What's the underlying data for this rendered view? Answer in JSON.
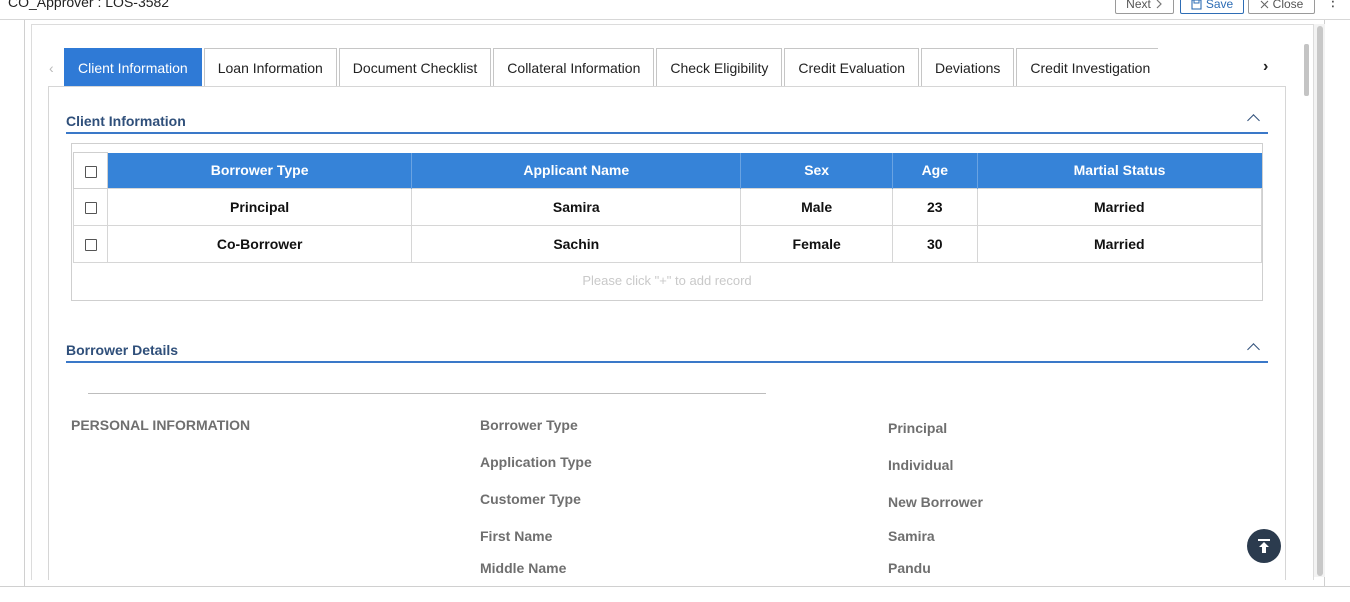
{
  "header": {
    "title": "CO_Approver : LOS-3582",
    "next_label": "Next",
    "save_label": "Save",
    "close_label": "Close",
    "next_icon": "chevron-right-icon",
    "save_icon": "save-icon",
    "close_icon": "close-icon",
    "menu_icon": "more-vertical-icon"
  },
  "tabs": [
    {
      "label": "Client Information",
      "active": true
    },
    {
      "label": "Loan Information",
      "active": false
    },
    {
      "label": "Document Checklist",
      "active": false
    },
    {
      "label": "Collateral Information",
      "active": false
    },
    {
      "label": "Check Eligibility",
      "active": false
    },
    {
      "label": "Credit Evaluation",
      "active": false
    },
    {
      "label": "Deviations",
      "active": false
    },
    {
      "label": "Credit Investigation",
      "active": false
    }
  ],
  "client_section": {
    "title": "Client Information",
    "columns": [
      "Borrower Type",
      "Applicant Name",
      "Sex",
      "Age",
      "Martial Status"
    ],
    "rows": [
      [
        "Principal",
        "Samira",
        "Male",
        "23",
        "Married"
      ],
      [
        "Co-Borrower",
        "Sachin",
        "Female",
        "30",
        "Married"
      ]
    ],
    "empty_hint": "Please click \"+\" to add record"
  },
  "borrower_section": {
    "title": "Borrower Details",
    "group_label": "PERSONAL INFORMATION",
    "fields": [
      {
        "label": "Borrower Type",
        "value": "Principal"
      },
      {
        "label": "Application Type",
        "value": "Individual"
      },
      {
        "label": "Customer Type",
        "value": "New Borrower"
      },
      {
        "label": "First Name",
        "value": "Samira"
      },
      {
        "label": "Middle Name",
        "value": "Pandu"
      }
    ]
  },
  "colors": {
    "accent": "#2f7ad6",
    "table_header": "#3683d8",
    "section_title": "#2f4f7a",
    "fab": "#2b3b4e"
  }
}
